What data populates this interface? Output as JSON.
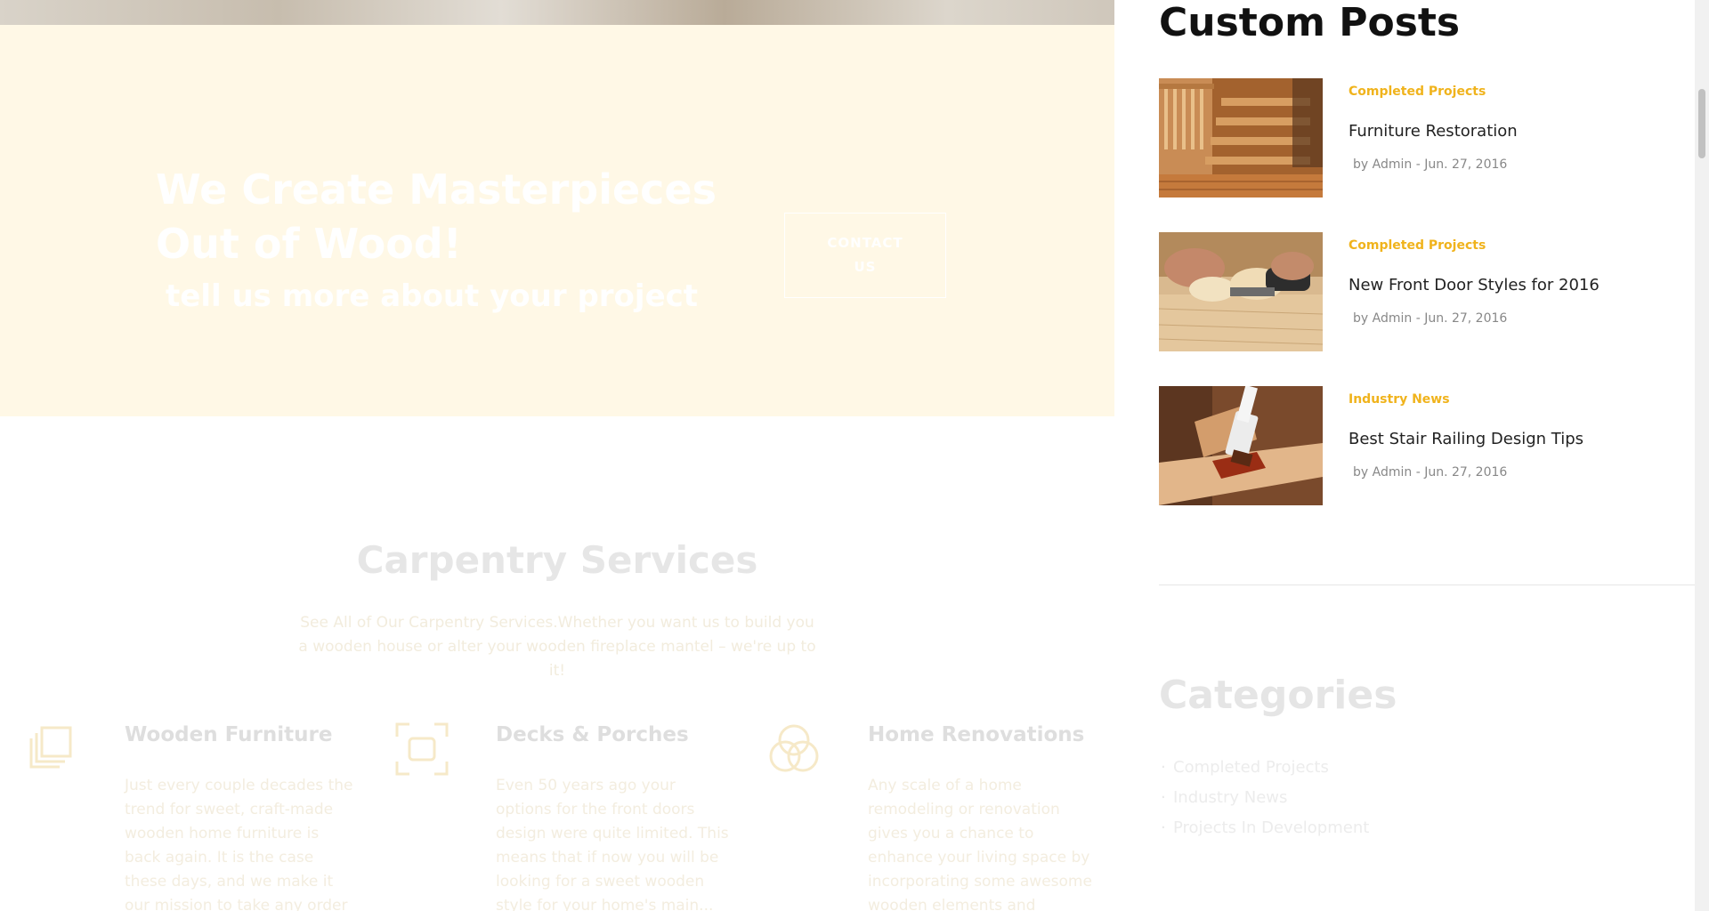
{
  "cta": {
    "title_line1": "We Create Masterpieces",
    "title_line2": "Out of Wood!",
    "subtitle": "tell us more about your project",
    "button_label": "CONTACT US"
  },
  "services": {
    "title": "Carpentry Services",
    "description": "See All of Our Carpentry Services.Whether you want us to build you a wooden house or alter your wooden fireplace mantel – we're up to it!",
    "items": [
      {
        "icon": "layers-icon",
        "title": "Wooden Furniture",
        "text": "Just every couple decades the trend for sweet, craft-made wooden home furniture is back again. It is the case these days, and we make it our mission to take any order"
      },
      {
        "icon": "focus-frame-icon",
        "title": "Decks & Porches",
        "text": "Even 50 years ago your options for the front doors design were quite limited. This means that if now you will be looking for a sweet wooden style for your home's main..."
      },
      {
        "icon": "circles-icon",
        "title": "Home Renovations",
        "text": "Any scale of a home remodeling or renovation gives you a chance to enhance your living space by incorporating some awesome wooden elements and"
      }
    ]
  },
  "sidebar": {
    "custom_posts_title": "Custom Posts",
    "posts": [
      {
        "category": "Completed Projects",
        "title": "Furniture Restoration",
        "meta": "by Admin - Jun. 27, 2016",
        "thumb": "stairs-photo"
      },
      {
        "category": "Completed Projects",
        "title": "New Front Door Styles for 2016",
        "meta": "by Admin - Jun. 27, 2016",
        "thumb": "wood-plane-photo"
      },
      {
        "category": "Industry News",
        "title": "Best Stair Railing Design Tips",
        "meta": "by Admin - Jun. 27, 2016",
        "thumb": "paint-brush-photo"
      }
    ],
    "categories_title": "Categories",
    "categories": [
      "Completed Projects",
      "Industry News",
      "Projects In Development"
    ]
  },
  "colors": {
    "accent": "#f0b31c",
    "cta_background": "#fff8e6"
  }
}
